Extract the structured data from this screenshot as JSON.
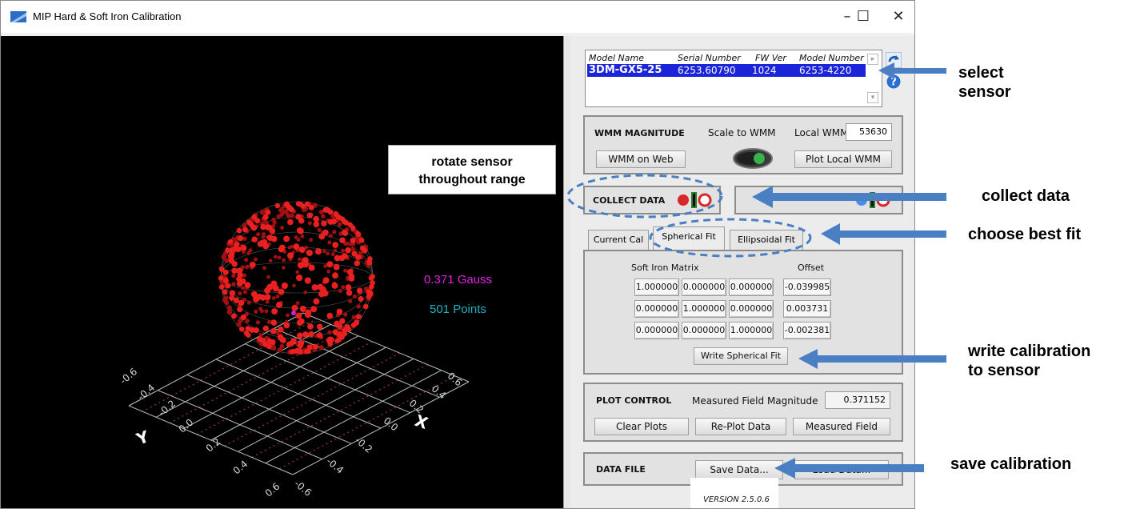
{
  "window": {
    "title": "MIP Hard & Soft Iron Calibration",
    "controls": {
      "minimize": "–",
      "maximize": "☐",
      "close": "✕"
    }
  },
  "plot": {
    "magnitude_text": "0.371 Gauss",
    "points_text": "501 Points",
    "magnitude_color": "#e020e0",
    "points_color": "#20b0c0",
    "x_axis_label": "X",
    "y_axis_label": "Y",
    "ticks_right": [
      "0.6",
      "0.4",
      "0.2",
      "0.0",
      "-0.2",
      "-0.4",
      "-0.6"
    ],
    "ticks_left": [
      "-0.6",
      "-0.4",
      "-0.2",
      "0.0",
      "0.2",
      "0.4",
      "0.6"
    ]
  },
  "sensor_list": {
    "columns": [
      "Model Name",
      "Serial Number",
      "FW Ver",
      "Model Number"
    ],
    "rows": [
      {
        "model_name": "3DM-GX5-25",
        "serial": "6253.60790",
        "fw": "1024",
        "model_number": "6253-4220"
      }
    ],
    "refresh_icon": "refresh-icon",
    "help_icon": "help-icon"
  },
  "wmm": {
    "heading": "WMM MAGNITUDE",
    "scale_label": "Scale to WMM",
    "local_label": "Local WMM:",
    "local_value": "53630",
    "web_button": "WMM on Web",
    "plot_button": "Plot Local WMM"
  },
  "collect": {
    "heading": "COLLECT DATA"
  },
  "tabs": {
    "items": [
      "Current Cal",
      "Spherical Fit",
      "Ellipsoidal Fit"
    ],
    "active": "Spherical Fit"
  },
  "fit": {
    "matrix_label": "Soft Iron Matrix",
    "offset_label": "Offset",
    "matrix": [
      [
        "1.000000",
        "0.000000",
        "0.000000"
      ],
      [
        "0.000000",
        "1.000000",
        "0.000000"
      ],
      [
        "0.000000",
        "0.000000",
        "1.000000"
      ]
    ],
    "offset": [
      "-0.039985",
      "0.003731",
      "-0.002381"
    ],
    "write_button": "Write Spherical Fit"
  },
  "plot_control": {
    "heading": "PLOT CONTROL",
    "measured_label": "Measured Field Magnitude",
    "measured_value": "0.371152",
    "clear_button": "Clear Plots",
    "replot_button": "Re-Plot Data",
    "measured_button": "Measured Field"
  },
  "data_file": {
    "heading": "DATA FILE",
    "save_button": "Save Data...",
    "load_button": "Load Data..."
  },
  "version": "VERSION 2.5.0.6",
  "annotations": {
    "rotate": [
      "rotate sensor",
      "throughout range"
    ],
    "select": [
      "select",
      "sensor"
    ],
    "collect": "collect data",
    "best_fit": "choose best fit",
    "write": [
      "write calibration",
      "to sensor"
    ],
    "save": "save calibration",
    "arrow_color": "#4a7fc4"
  }
}
